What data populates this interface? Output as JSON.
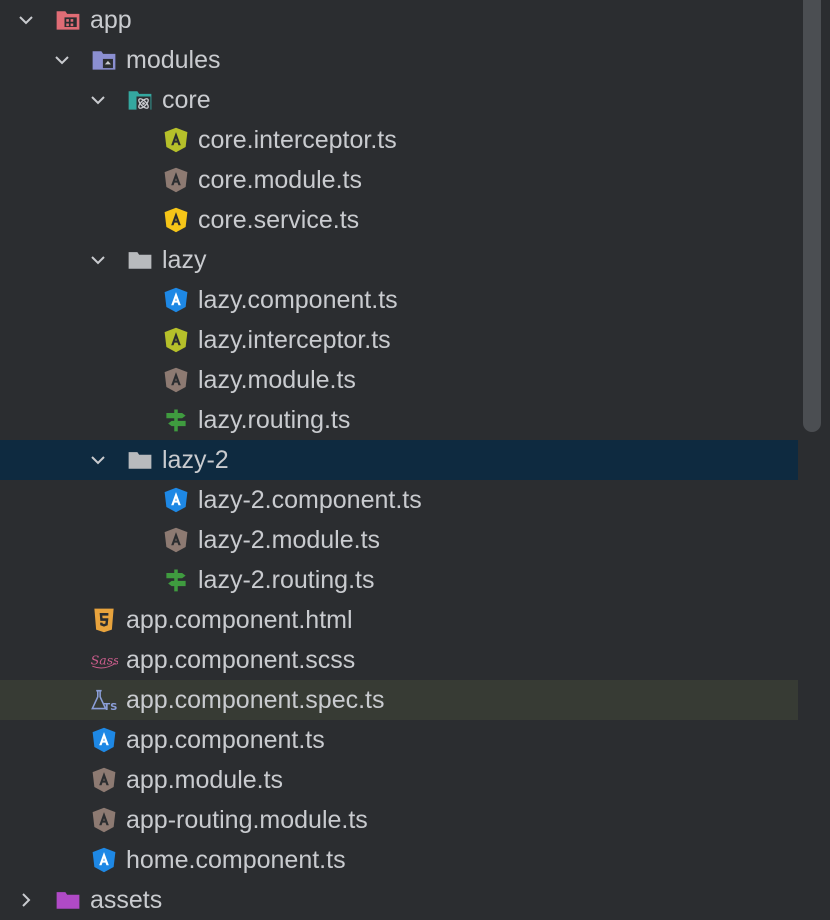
{
  "tree": {
    "rows": [
      {
        "label": "app",
        "icon": "app-folder-icon",
        "chevron": "expanded",
        "state": ""
      },
      {
        "label": "modules",
        "icon": "modules-folder-icon",
        "chevron": "expanded",
        "state": ""
      },
      {
        "label": "core",
        "icon": "core-folder-icon",
        "chevron": "expanded",
        "state": ""
      },
      {
        "label": "core.interceptor.ts",
        "icon": "angular-interceptor-icon",
        "chevron": "",
        "state": ""
      },
      {
        "label": "core.module.ts",
        "icon": "angular-module-icon",
        "chevron": "",
        "state": ""
      },
      {
        "label": "core.service.ts",
        "icon": "angular-service-icon",
        "chevron": "",
        "state": ""
      },
      {
        "label": "lazy",
        "icon": "folder-icon",
        "chevron": "expanded",
        "state": ""
      },
      {
        "label": "lazy.component.ts",
        "icon": "angular-component-icon",
        "chevron": "",
        "state": ""
      },
      {
        "label": "lazy.interceptor.ts",
        "icon": "angular-interceptor-icon",
        "chevron": "",
        "state": ""
      },
      {
        "label": "lazy.module.ts",
        "icon": "angular-module-icon",
        "chevron": "",
        "state": ""
      },
      {
        "label": "lazy.routing.ts",
        "icon": "routing-signpost-icon",
        "chevron": "",
        "state": ""
      },
      {
        "label": "lazy-2",
        "icon": "folder-icon",
        "chevron": "expanded",
        "state": "selected"
      },
      {
        "label": "lazy-2.component.ts",
        "icon": "angular-component-icon",
        "chevron": "",
        "state": ""
      },
      {
        "label": "lazy-2.module.ts",
        "icon": "angular-module-icon",
        "chevron": "",
        "state": ""
      },
      {
        "label": "lazy-2.routing.ts",
        "icon": "routing-signpost-icon",
        "chevron": "",
        "state": ""
      },
      {
        "label": "app.component.html",
        "icon": "html5-icon",
        "chevron": "",
        "state": ""
      },
      {
        "label": "app.component.scss",
        "icon": "sass-icon",
        "chevron": "",
        "state": ""
      },
      {
        "label": "app.component.spec.ts",
        "icon": "test-flask-ts-icon",
        "chevron": "",
        "state": "highlighted"
      },
      {
        "label": "app.component.ts",
        "icon": "angular-component-icon",
        "chevron": "",
        "state": ""
      },
      {
        "label": "app.module.ts",
        "icon": "angular-module-icon",
        "chevron": "",
        "state": ""
      },
      {
        "label": "app-routing.module.ts",
        "icon": "angular-module-icon",
        "chevron": "",
        "state": ""
      },
      {
        "label": "home.component.ts",
        "icon": "angular-component-icon",
        "chevron": "",
        "state": ""
      },
      {
        "label": "assets",
        "icon": "assets-folder-icon",
        "chevron": "collapsed",
        "state": ""
      }
    ]
  },
  "colors": {
    "background": "#2b2d30",
    "selected": "#0e2a40",
    "highlighted": "#373b34",
    "text": "#c9cbcf",
    "angular_component": "#1e88e5",
    "angular_module": "#8d7a72",
    "angular_service": "#f5c518",
    "angular_interceptor": "#b6c02a",
    "routing": "#3f9b3f",
    "html5": "#e8a33d",
    "sass": "#cd5d8d"
  }
}
